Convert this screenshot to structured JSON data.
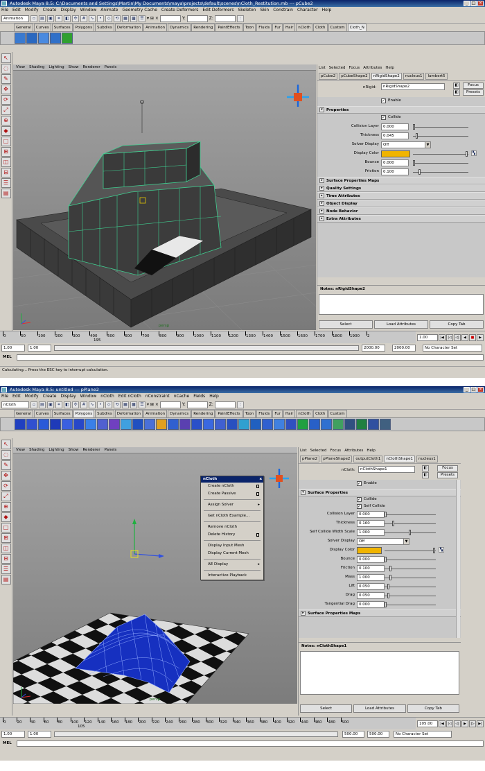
{
  "window1": {
    "title": "Autodesk Maya 8.5: C:\\Documents and Settings\\Martin\\My Documents\\maya\\projects\\default\\scenes\\nCloth_Restitution.mb  ---  pCube2",
    "menus": [
      "File",
      "Edit",
      "Modify",
      "Create",
      "Display",
      "Window",
      "Animate",
      "Geometry Cache",
      "Create Deformers",
      "Edit Deformers",
      "Skeleton",
      "Skin",
      "Constrain",
      "Character",
      "Help"
    ],
    "menuset": "Animation",
    "field_x_label": "X:",
    "field_y_label": "Y:",
    "field_z_label": "Z:",
    "shelf_tabs": [
      "General",
      "Curves",
      "Surfaces",
      "Polygons",
      "Subdivs",
      "Deformation",
      "Animation",
      "Dynamics",
      "Rendering",
      "PaintEffects",
      "Toon",
      "Fluids",
      "Fur",
      "Hair",
      "nCloth",
      "Cloth",
      "Custom",
      "Cloth_N"
    ],
    "active_shelf": "Cloth_N",
    "viewport_menu": [
      "View",
      "Shading",
      "Lighting",
      "Show",
      "Renderer",
      "Panels"
    ],
    "camera_label": "persp",
    "ae_menu": [
      "List",
      "Selected",
      "Focus",
      "Attributes",
      "Help"
    ],
    "ae_tabs": [
      "pCube2",
      "pCubeShape2",
      "nRigidShape2",
      "nucleus1",
      "lambert5"
    ],
    "active_ae_tab": "nRigidShape2",
    "node_label": "nRigid:",
    "node_name": "nRigidShape2",
    "focus_label": "Focus",
    "presets_label": "Presets",
    "enable_label": "Enable",
    "properties_header": "Properties",
    "collide_label": "Collide",
    "attrs": [
      {
        "label": "Collision Layer",
        "value": "0.000",
        "slider": 0.0
      },
      {
        "label": "Thickness",
        "value": "0.045",
        "slider": 0.05
      }
    ],
    "solver_display_label": "Solver Display",
    "solver_display_value": "Off",
    "display_color_label": "Display Color",
    "display_color": "#f0b400",
    "attrs2": [
      {
        "label": "Bounce",
        "value": "0.000",
        "slider": 0.0
      },
      {
        "label": "Friction",
        "value": "0.100",
        "slider": 0.1
      }
    ],
    "sections": [
      "Surface Properties Maps",
      "Quality Settings",
      "Time Attributes",
      "Object Display",
      "Node Behavior",
      "Extra Attributes"
    ],
    "notes_label": "Notes:  nRigidShape2",
    "footer_buttons": [
      "Select",
      "Load Attributes",
      "Copy Tab"
    ],
    "timeline_ticks": [
      "0",
      "50",
      "100",
      "200",
      "300",
      "400",
      "500",
      "600",
      "700",
      "800",
      "900",
      "1000",
      "1100",
      "1200",
      "1300",
      "1400",
      "1500",
      "1600",
      "1700",
      "1800",
      "1900",
      "2"
    ],
    "current_frame_tick": "195",
    "current_frame": "1.00",
    "range_start": "1.00",
    "range_inner_start": "1.00",
    "range_end": "2000.00",
    "range_end2": "2000.00",
    "char_set": "No Character Set",
    "mel_label": "MEL",
    "status": "Calculating...  Press the ESC key to interrupt calculation."
  },
  "window2": {
    "title": "Autodesk Maya 8.5: untitled   ---  pPlane2",
    "menus": [
      "File",
      "Edit",
      "Modify",
      "Create",
      "Display",
      "Window",
      "nCloth",
      "Edit nCloth",
      "nConstraint",
      "nCache",
      "Fields",
      "Help"
    ],
    "menuset": "nCloth",
    "field_x_label": "X:",
    "field_y_label": "Y:",
    "field_z_label": "Z:",
    "shelf_tabs": [
      "General",
      "Curves",
      "Surfaces",
      "Polygons",
      "Subdivs",
      "Deformation",
      "Animation",
      "Dynamics",
      "Rendering",
      "PaintEffects",
      "Toon",
      "Fluids",
      "Fur",
      "Hair",
      "nCloth",
      "Cloth",
      "Custom"
    ],
    "active_shelf": "Polygons",
    "viewport_menu": [
      "View",
      "Shading",
      "Lighting",
      "Show",
      "Renderer",
      "Panels"
    ],
    "camera_label": "persp",
    "ae_menu": [
      "List",
      "Selected",
      "Focus",
      "Attributes",
      "Help"
    ],
    "ae_tabs": [
      "pPlane2",
      "pPlaneShape2",
      "outputCloth1",
      "nClothShape1",
      "nucleus1"
    ],
    "active_ae_tab": "nClothShape1",
    "node_label": "nCloth:",
    "node_name": "nClothShape1",
    "focus_label": "Focus",
    "presets_label": "Presets",
    "enable_label": "Enable",
    "surface_header": "Surface Properties",
    "collide_label": "Collide",
    "self_collide_label": "Self Collide",
    "attrs": [
      {
        "label": "Collision Layer",
        "value": "0.000",
        "slider": 0.0
      },
      {
        "label": "Thickness",
        "value": "0.160",
        "slider": 0.16
      },
      {
        "label": "Self Collide Width Scale",
        "value": "1.000",
        "slider": 0.5
      }
    ],
    "solver_display_label": "Solver Display",
    "solver_display_value": "Off",
    "display_color_label": "Display Color",
    "display_color": "#f0b400",
    "attrs2": [
      {
        "label": "Bounce",
        "value": "0.000",
        "slider": 0.0
      },
      {
        "label": "Friction",
        "value": "0.100",
        "slider": 0.1
      },
      {
        "label": "Mass",
        "value": "1.000",
        "slider": 0.1
      },
      {
        "label": "Lift",
        "value": "0.050",
        "slider": 0.05
      },
      {
        "label": "Drag",
        "value": "0.050",
        "slider": 0.05
      },
      {
        "label": "Tangential Drag",
        "value": "0.000",
        "slider": 0.0
      }
    ],
    "sections": [
      "Surface Properties Maps"
    ],
    "notes_label": "Notes:  nClothShape1",
    "footer_buttons": [
      "Select",
      "Load Attributes",
      "Copy Tab"
    ],
    "popup": {
      "title": "nCloth",
      "close": "x",
      "items": [
        {
          "label": "Create nCloth",
          "opt": true
        },
        {
          "label": "Create Passive",
          "opt": true
        },
        {
          "sep": true
        },
        {
          "label": "Assign Solver",
          "sub": true
        },
        {
          "sep": true
        },
        {
          "label": "Get nCloth Example..."
        },
        {
          "sep": true
        },
        {
          "label": "Remove nCloth"
        },
        {
          "label": "Delete History",
          "opt": true
        },
        {
          "sep": true
        },
        {
          "label": "Display Input Mesh"
        },
        {
          "label": "Display Current Mesh"
        },
        {
          "sep": true
        },
        {
          "label": "AE Display",
          "sub": true
        },
        {
          "sep": true
        },
        {
          "label": "Interactive Playback"
        }
      ]
    },
    "timeline_ticks": [
      "0",
      "20",
      "40",
      "60",
      "80",
      "100",
      "120",
      "140",
      "160",
      "180",
      "200",
      "220",
      "240",
      "260",
      "280",
      "300",
      "320",
      "340",
      "360",
      "380",
      "400",
      "420",
      "440",
      "460",
      "480",
      "500"
    ],
    "current_frame_tick": "105",
    "current_frame": "105.00",
    "range_start": "1.00",
    "range_inner_start": "1.00",
    "range_end": "500.00",
    "range_end2": "500.00",
    "char_set": "No Character Set",
    "mel_label": "MEL"
  }
}
